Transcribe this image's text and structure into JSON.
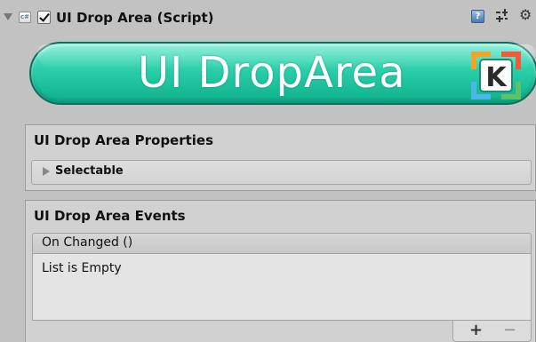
{
  "component": {
    "title": "UI Drop Area (Script)",
    "enabled": true,
    "script_icon_text": "c#",
    "help_icon_text": "?",
    "gear_glyph": "⚙"
  },
  "banner": {
    "text": "UI DropArea",
    "logo_letter": "K"
  },
  "properties": {
    "title": "UI Drop Area Properties",
    "foldout_label": "Selectable"
  },
  "events": {
    "title": "UI Drop Area Events",
    "event_name": "On Changed ()",
    "empty_text": "List is Empty",
    "add_label": "+",
    "remove_label": "−"
  },
  "colors": {
    "background": "#c2c2c2",
    "banner": "#2acea8",
    "banner_border": "#0c6f5d"
  }
}
